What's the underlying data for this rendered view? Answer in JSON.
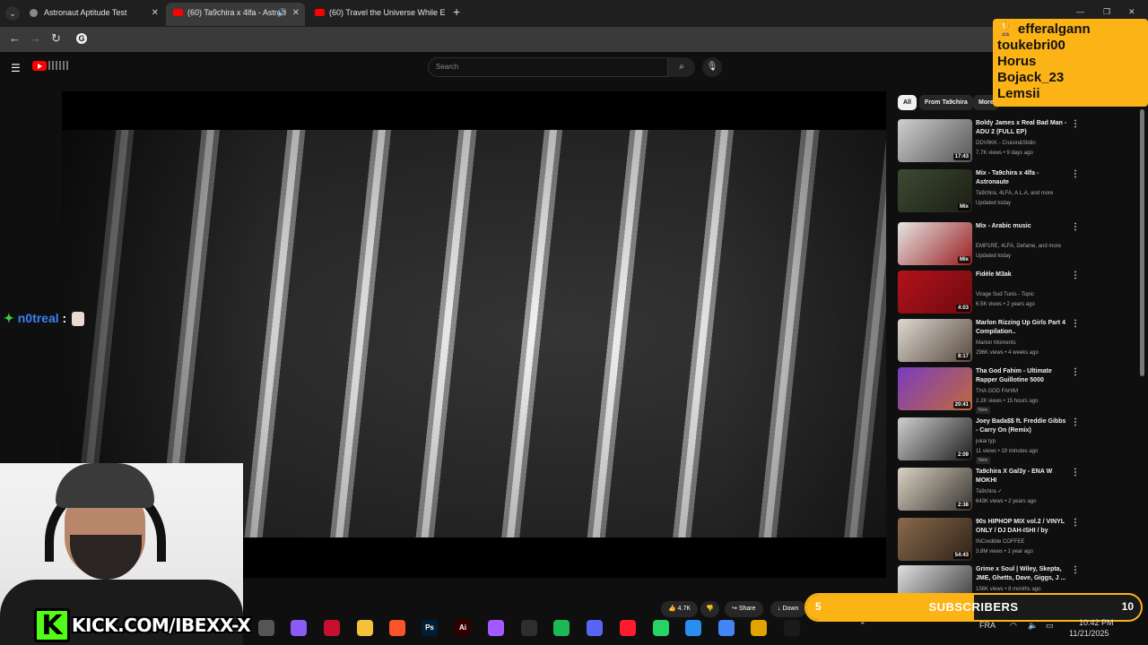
{
  "browser": {
    "tabs": [
      {
        "title": "Astronaut Aptitude Test",
        "active": false,
        "favicon": "globe-icon"
      },
      {
        "title": "(60) Ta9chira x 4lfa - Astron",
        "active": true,
        "favicon": "youtube-icon"
      },
      {
        "title": "(60) Travel the Universe While E",
        "active": false,
        "favicon": "youtube-icon"
      }
    ],
    "new_tab": "+",
    "google_letter": "G",
    "window_controls": [
      "—",
      "❐",
      "✕"
    ]
  },
  "youtube": {
    "search_placeholder": "Search",
    "actions": {
      "likes": "4.7K",
      "share": "Share",
      "download": "Down"
    },
    "chips": [
      "All",
      "From Ta9chira",
      "More"
    ],
    "recommendations": [
      {
        "title": "Boldy James x Real Bad Man - ADU 2 (FULL EP)",
        "channel": "DDV8KK - Cruisin&Slidin",
        "meta": "7.7K views • 9 days ago",
        "duration": "17:43",
        "new": false,
        "thumb": [
          "#cfcfcf",
          "#555"
        ]
      },
      {
        "title": "Mix - Ta9chira x 4lfa - Astronaute",
        "channel": "Ta9chira, 4LFA, A.L.A, and more",
        "meta": "Updated today",
        "duration": "Mix",
        "new": false,
        "thumb": [
          "#3d4a33",
          "#1b1e14"
        ]
      },
      {
        "title": "Mix - Arabic music",
        "channel": "EMP1RE, 4LFA, Defame, and more",
        "meta": "Updated today",
        "duration": "Mix",
        "new": false,
        "thumb": [
          "#e5e5e5",
          "#9a1e1e"
        ]
      },
      {
        "title": "Fidèle M3ak",
        "channel": "Virage Sud Tunis - Topic",
        "meta": "6.5K views • 2 years ago",
        "duration": "4:03",
        "new": false,
        "thumb": [
          "#b3121b",
          "#6f0a0f"
        ]
      },
      {
        "title": "Marlon Rizzing Up Girls Part 4 Compilation..",
        "channel": "Marlon Moments",
        "meta": "296K views • 4 weeks ago",
        "duration": "8:17",
        "new": false,
        "thumb": [
          "#ddd8d0",
          "#5a4a40"
        ]
      },
      {
        "title": "Tha God Fahim - Ultimate Rapper Guillotine 5000",
        "channel": "THA GOD FAHIM",
        "meta": "2.2K views • 15 hours ago",
        "duration": "20:41",
        "new": true,
        "thumb": [
          "#7a3cc0",
          "#c06a3a"
        ]
      },
      {
        "title": "Joey Bada$$ ft. Freddie Gibbs - Carry On (Remix)",
        "channel": "jukai typ",
        "meta": "11 views • 19 minutes ago",
        "duration": "2:09",
        "new": true,
        "thumb": [
          "#cfcfcf",
          "#1e1e1e"
        ]
      },
      {
        "title": "Ta9chira X Gal3y - ENA W MOKHI",
        "channel": "Ta9chira ✓",
        "meta": "643K views • 2 years ago",
        "duration": "2:38",
        "new": false,
        "thumb": [
          "#d8d2c2",
          "#3a3530"
        ]
      },
      {
        "title": "90s HIPHOP MIX vol.2 / VINYL ONLY / DJ DAH-ISHI / by MUSI...",
        "channel": "INCredible COFFEE",
        "meta": "3.8M views • 1 year ago",
        "duration": "54:43",
        "new": false,
        "thumb": [
          "#8a6a4a",
          "#2e2218"
        ]
      },
      {
        "title": "Grime x Soul | Wiley, Skepta, JME, Ghetts, Dave, Giggs, J ...",
        "channel": "",
        "meta": "156K views • 8 months ago",
        "duration": "",
        "new": false,
        "thumb": [
          "#e0e0e0",
          "#333"
        ]
      }
    ]
  },
  "overlay": {
    "chat": {
      "user": "n0treal",
      "separator": ":"
    },
    "donors": [
      "efferalgann",
      "toukebri00",
      "Horus",
      "Bojack_23",
      "Lemsii"
    ],
    "donors_icon": "trophy-icon",
    "kick_letter": "K",
    "kick_url": "KICK.COM/IBEXX-X",
    "subscribers": {
      "label": "SUBSCRIBERS",
      "current": "5",
      "goal": "10",
      "progress": 0.5
    }
  },
  "taskbar": {
    "apps": [
      {
        "name": "task-view-icon",
        "label": "",
        "color": "#555"
      },
      {
        "name": "copilot-icon",
        "label": "",
        "color": "#8a5cf6"
      },
      {
        "name": "mcafee-icon",
        "label": "",
        "color": "#c8102e"
      },
      {
        "name": "file-explorer-icon",
        "label": "",
        "color": "#f3c13a"
      },
      {
        "name": "brave-icon",
        "label": "",
        "color": "#fb542b"
      },
      {
        "name": "photoshop-icon",
        "label": "Ps",
        "color": "#001e36"
      },
      {
        "name": "illustrator-icon",
        "label": "Ai",
        "color": "#330000"
      },
      {
        "name": "figma-icon",
        "label": "",
        "color": "#a259ff"
      },
      {
        "name": "obs-icon",
        "label": "",
        "color": "#302e31"
      },
      {
        "name": "spotify-icon",
        "label": "",
        "color": "#1db954"
      },
      {
        "name": "discord-icon",
        "label": "",
        "color": "#5865f2"
      },
      {
        "name": "opera-icon",
        "label": "",
        "color": "#ff1b2d"
      },
      {
        "name": "whatsapp-icon",
        "label": "",
        "color": "#25d366"
      },
      {
        "name": "snipping-icon",
        "label": "",
        "color": "#2a8df0"
      },
      {
        "name": "chrome-icon",
        "label": "",
        "color": "#4285f4"
      },
      {
        "name": "stack-icon",
        "label": "",
        "color": "#e2a500"
      },
      {
        "name": "app-icon",
        "label": "",
        "color": "#1a1a1a"
      }
    ],
    "language": "FRA",
    "time": "10:42 PM",
    "date": "11/21/2025"
  }
}
